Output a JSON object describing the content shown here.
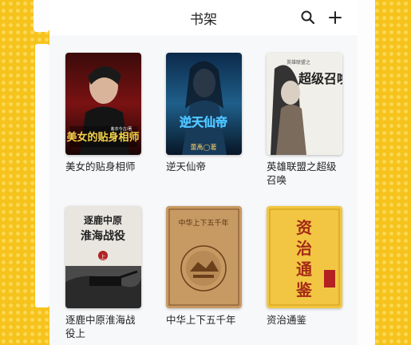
{
  "header": {
    "title": "书架"
  },
  "books": [
    {
      "title": "美女的贴身相师",
      "cover_text": "美女的贴身相师",
      "cover_author": "紫衣今古/著"
    },
    {
      "title": "逆天仙帝",
      "cover_text": "逆天仙帝",
      "cover_author": "蕾禹◯著"
    },
    {
      "title": "英雄联盟之超级召唤",
      "cover_text": "超级召唤",
      "cover_sub": "英雄联盟之"
    },
    {
      "title": "逐鹿中原淮海战役上",
      "cover_text_1": "逐鹿中原",
      "cover_text_2": "淮海战役",
      "cover_tag": "上"
    },
    {
      "title": "中华上下五千年",
      "cover_text": "中华上下五千年"
    },
    {
      "title": "资治通鉴",
      "cover_text": "资治通鉴"
    }
  ],
  "colors": {
    "background_yellow": "#f6c31d",
    "shelf_bg": "#f7f8fa",
    "title_text": "#222222"
  },
  "icons": {
    "search": "search-icon",
    "add": "add-icon"
  }
}
